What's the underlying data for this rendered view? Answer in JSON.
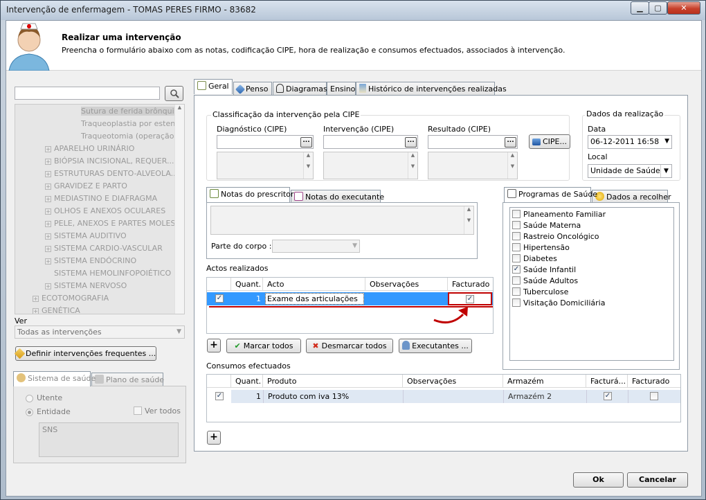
{
  "window": {
    "title": "Intervenção de enfermagem - TOMAS PERES FIRMO - 83682"
  },
  "header": {
    "title": "Realizar uma intervenção",
    "subtitle": "Preencha o formulário abaixo com as notas, codificação CIPE, hora de realização e consumos efectuados, associados à intervenção."
  },
  "left": {
    "search_value": "",
    "tree": [
      {
        "label": "Sutura de ferida brônquica",
        "level": 3,
        "expander": false
      },
      {
        "label": "Traqueoplastia por esten...",
        "level": 3,
        "expander": false
      },
      {
        "label": "Traqueotomia (operação...",
        "level": 3,
        "expander": false
      },
      {
        "label": "APARELHO URINÁRIO",
        "level": 2,
        "expander": true
      },
      {
        "label": "BIÓPSIA INCISIONAL, REQUER...",
        "level": 2,
        "expander": true
      },
      {
        "label": "ESTRUTURAS DENTO-ALVEOLA...",
        "level": 2,
        "expander": true
      },
      {
        "label": "GRAVIDEZ E PARTO",
        "level": 2,
        "expander": true
      },
      {
        "label": "MEDIASTINO E DIAFRAGMA",
        "level": 2,
        "expander": true
      },
      {
        "label": "OLHOS E ANEXOS OCULARES",
        "level": 2,
        "expander": true
      },
      {
        "label": "PELE, ANEXOS E PARTES MOLES",
        "level": 2,
        "expander": true
      },
      {
        "label": "SISTEMA AUDITIVO",
        "level": 2,
        "expander": true
      },
      {
        "label": "SISTEMA CARDIO-VASCULAR",
        "level": 2,
        "expander": true
      },
      {
        "label": "SISTEMA ENDÓCRINO",
        "level": 2,
        "expander": true
      },
      {
        "label": "SISTEMA HEMOLINFOPOIÉTICO",
        "level": 2,
        "expander": false
      },
      {
        "label": "SISTEMA NERVOSO",
        "level": 2,
        "expander": true
      },
      {
        "label": "ECOTOMOGRAFIA",
        "level": 1,
        "expander": true
      },
      {
        "label": "GENÉTICA",
        "level": 1,
        "expander": true
      }
    ],
    "ver_label": "Ver",
    "ver_value": "Todas as intervenções",
    "define_button": "Definir intervenções frequentes ...",
    "tabs": [
      "Sistema de saúde",
      "Plano de saúde"
    ],
    "radio_utente": "Utente",
    "radio_entidade": "Entidade",
    "ver_todos": "Ver todos",
    "sns": "SNS"
  },
  "tabs": [
    "Geral",
    "Penso",
    "Diagramas",
    "Ensino",
    "Histórico de intervenções realizadas"
  ],
  "cipe": {
    "group_title": "Classificação da intervenção pela CIPE",
    "diagnostico_label": "Diagnóstico (CIPE)",
    "intervencao_label": "Intervenção (CIPE)",
    "resultado_label": "Resultado (CIPE)",
    "ellipsis": "...",
    "cipe_button": "CIPE..."
  },
  "realizacao": {
    "title": "Dados da realização",
    "data_label": "Data",
    "data_value": "06-12-2011 16:58",
    "local_label": "Local",
    "local_value": "Unidade de Saúde E"
  },
  "notes": {
    "tabs": [
      "Notas do prescritor",
      "Notas do executante"
    ],
    "parte_label": "Parte do corpo :"
  },
  "actos": {
    "title": "Actos realizados",
    "headers": [
      "Quant.",
      "Acto",
      "Observações",
      "Facturado"
    ],
    "rows": [
      {
        "checked": true,
        "quant": "1",
        "acto": "Exame das articulações",
        "obs": "",
        "facturado": true
      }
    ]
  },
  "programas": {
    "tabs": [
      "Programas de Saúde",
      "Dados a recolher"
    ],
    "items": [
      {
        "label": "Planeamento Familiar",
        "checked": false
      },
      {
        "label": "Saúde Materna",
        "checked": false
      },
      {
        "label": "Rastreio Oncológico",
        "checked": false
      },
      {
        "label": "Hipertensão",
        "checked": false
      },
      {
        "label": "Diabetes",
        "checked": false
      },
      {
        "label": "Saúde Infantil",
        "checked": true
      },
      {
        "label": "Saúde Adultos",
        "checked": false
      },
      {
        "label": "Tuberculose",
        "checked": false
      },
      {
        "label": "Visitação Domiciliária",
        "checked": false
      }
    ]
  },
  "buttons": {
    "marcar": "Marcar todos",
    "desmarcar": "Desmarcar todos",
    "executantes": "Executantes ...",
    "plus": "+",
    "ok": "Ok",
    "cancelar": "Cancelar"
  },
  "consumos": {
    "title": "Consumos efectuados",
    "headers": [
      "Quant.",
      "Produto",
      "Observações",
      "Armazém",
      "Facturá...",
      "Facturado"
    ],
    "rows": [
      {
        "checked": true,
        "quant": "1",
        "produto": "Produto com iva 13%",
        "obs": "",
        "armazem": "Armazém 2",
        "facturavel": true,
        "facturado": false
      }
    ]
  },
  "colors": {
    "selection": "#3399ff",
    "highlight": "#c00000",
    "row_bg": "#dfe8f3"
  }
}
